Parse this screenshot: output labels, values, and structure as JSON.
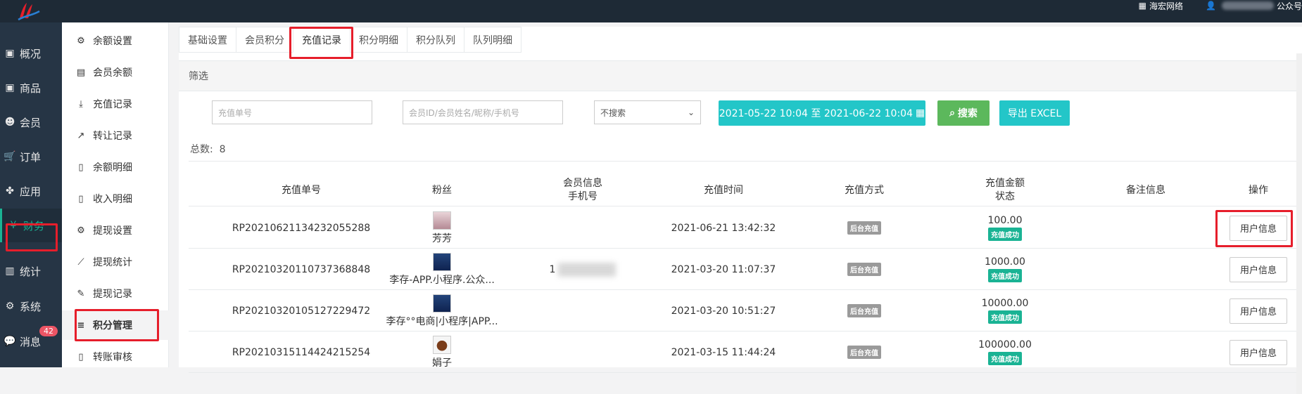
{
  "topbar": {
    "company": "海宏网络",
    "account_suffix": "公众号"
  },
  "nav": [
    {
      "label": "概况",
      "icon": "dashboard-icon"
    },
    {
      "label": "商品",
      "icon": "box-icon"
    },
    {
      "label": "会员",
      "icon": "users-icon"
    },
    {
      "label": "订单",
      "icon": "cart-icon"
    },
    {
      "label": "应用",
      "icon": "apps-icon"
    },
    {
      "label": "财务",
      "icon": "finance-icon"
    },
    {
      "label": "统计",
      "icon": "bar-chart-icon"
    },
    {
      "label": "系统",
      "icon": "gears-icon"
    },
    {
      "label": "消息",
      "icon": "comment-icon"
    }
  ],
  "messages_badge": "42",
  "subnav": [
    {
      "label": "余额设置",
      "icon": "gear-icon"
    },
    {
      "label": "会员余额",
      "icon": "book-icon"
    },
    {
      "label": "充值记录",
      "icon": "download-icon"
    },
    {
      "label": "转让记录",
      "icon": "share-icon"
    },
    {
      "label": "余额明细",
      "icon": "file-icon"
    },
    {
      "label": "收入明细",
      "icon": "file-icon"
    },
    {
      "label": "提现设置",
      "icon": "gear-icon"
    },
    {
      "label": "提现统计",
      "icon": "line-chart-icon"
    },
    {
      "label": "提现记录",
      "icon": "pencil-icon"
    },
    {
      "label": "积分管理",
      "icon": "database-icon"
    },
    {
      "label": "转账审核",
      "icon": "file-icon"
    }
  ],
  "tabs": [
    "基础设置",
    "会员积分",
    "充值记录",
    "积分明细",
    "积分队列",
    "队列明细"
  ],
  "filter": {
    "title": "筛选",
    "order_placeholder": "充值单号",
    "member_placeholder": "会员ID/会员姓名/昵称/手机号",
    "select_value": "不搜索",
    "date_range": "2021-05-22 10:04 至 2021-06-22 10:04",
    "search_label": "搜索",
    "export_label": "导出 EXCEL"
  },
  "total_label": "总数:",
  "total_value": "8",
  "columns": {
    "order_no": "充值单号",
    "fan": "粉丝",
    "member_info": "会员信息",
    "member_phone": "手机号",
    "time": "充值时间",
    "method": "充值方式",
    "amount": "充值金额",
    "status": "状态",
    "remark": "备注信息",
    "action": "操作"
  },
  "rows": [
    {
      "order_no": "RP20210621134232055288",
      "fan": "芳芳",
      "phone": "",
      "time": "2021-06-21 13:42:32",
      "method": "后台充值",
      "amount": "100.00",
      "status": "充值成功",
      "action": "用户信息"
    },
    {
      "order_no": "RP20210320110737368848",
      "fan": "李存-APP.小程序.公众...",
      "phone": "1",
      "time": "2021-03-20 11:07:37",
      "method": "后台充值",
      "amount": "1000.00",
      "status": "充值成功",
      "action": "用户信息"
    },
    {
      "order_no": "RP20210320105127229472",
      "fan": "李存°°电商|小程序|APP...",
      "phone": "",
      "time": "2021-03-20 10:51:27",
      "method": "后台充值",
      "amount": "10000.00",
      "status": "充值成功",
      "action": "用户信息"
    },
    {
      "order_no": "RP20210315114424215254",
      "fan": "娟子",
      "phone": "",
      "time": "2021-03-15 11:44:24",
      "method": "后台充值",
      "amount": "100000.00",
      "status": "充值成功",
      "action": "用户信息"
    }
  ],
  "colors": {
    "sidebar": "#263545",
    "accent": "#1ab394",
    "info": "#23c6c8",
    "success": "#5cb85c",
    "highlight": "#e61e2b"
  }
}
